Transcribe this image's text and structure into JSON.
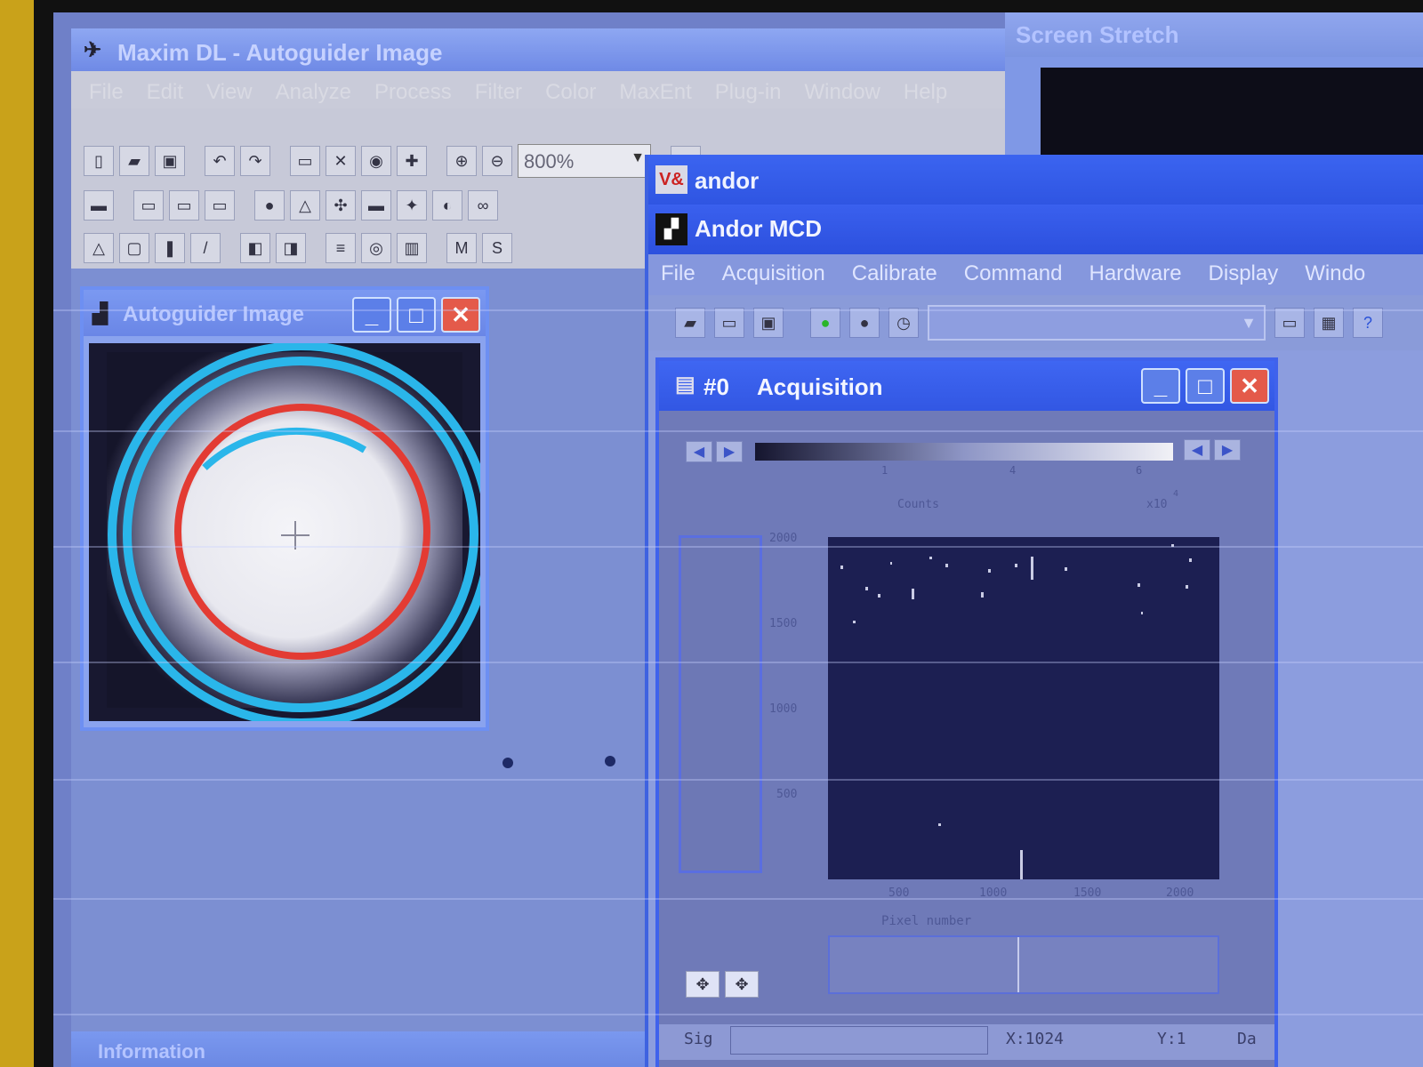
{
  "maxim": {
    "title": "Maxim DL - Autoguider Image",
    "menu": [
      "File",
      "Edit",
      "View",
      "Analyze",
      "Process",
      "Filter",
      "Color",
      "MaxEnt",
      "Plug-in",
      "Window",
      "Help"
    ],
    "zoom": "800%",
    "autoguider": {
      "title": "Autoguider Image"
    },
    "info_title": "Information"
  },
  "stretch": {
    "title": "Screen Stretch"
  },
  "andor": {
    "title": "andor",
    "va_icon": "V&",
    "mcd_title": "Andor MCD",
    "menu": [
      "File",
      "Acquisition",
      "Calibrate",
      "Command",
      "Hardware",
      "Display",
      "Windo"
    ],
    "acquisition": {
      "number": "#0",
      "title": "Acquisition",
      "colorbar": {
        "ticks": [
          "1",
          "4",
          "6"
        ],
        "label": "Counts",
        "scale": "x10",
        "exponent": "4"
      },
      "y_ticks": [
        "2000",
        "1500",
        "1000",
        "500"
      ],
      "x_ticks": [
        "500",
        "1000",
        "1500",
        "2000"
      ],
      "x_label": "Pixel number",
      "status": {
        "left": "Sig",
        "x": "X:1024",
        "y": "Y:1",
        "right": "Da"
      }
    }
  },
  "icons": {
    "app": "maxim-telescope-icon",
    "doc": "document-icon",
    "minimize": "minimize-icon",
    "maximize": "maximize-icon",
    "close": "close-icon"
  }
}
